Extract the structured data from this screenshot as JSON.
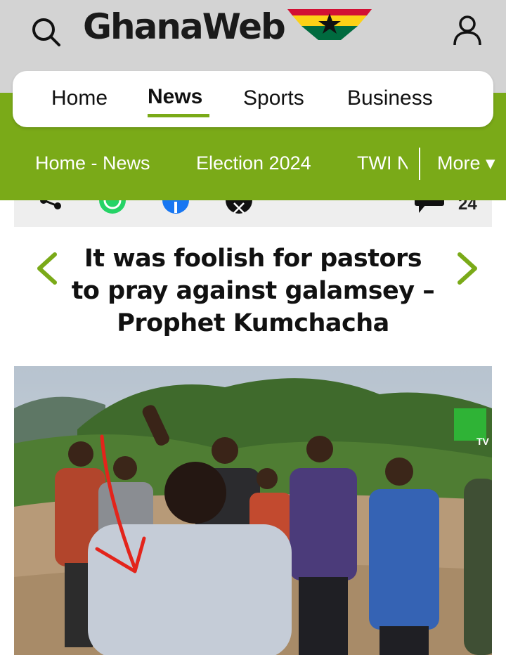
{
  "header": {
    "logo_text": "GhanaWeb",
    "search_icon": "search-icon",
    "user_icon": "user-icon"
  },
  "main_nav": {
    "items": [
      {
        "label": "Home"
      },
      {
        "label": "News",
        "active": true
      },
      {
        "label": "Sports"
      },
      {
        "label": "Business"
      }
    ]
  },
  "sub_nav": {
    "items": [
      {
        "label": "Home - News"
      },
      {
        "label": "Election 2024"
      },
      {
        "label": "TWI NEWS"
      }
    ],
    "more_label": "More ▾"
  },
  "share_bar": {
    "icons": [
      "share-icon",
      "whatsapp-icon",
      "facebook-icon",
      "x-icon"
    ],
    "comment_count": "24"
  },
  "article": {
    "headline": "It was foolish for pastors to pray against galamsey – Prophet Kumchacha",
    "image_watermark": "TV"
  },
  "colors": {
    "brand_green": "#7aaa18",
    "header_gray": "#d3d3d3",
    "flag_red": "#d21034",
    "flag_gold": "#fcd116",
    "flag_green": "#006b3f"
  }
}
